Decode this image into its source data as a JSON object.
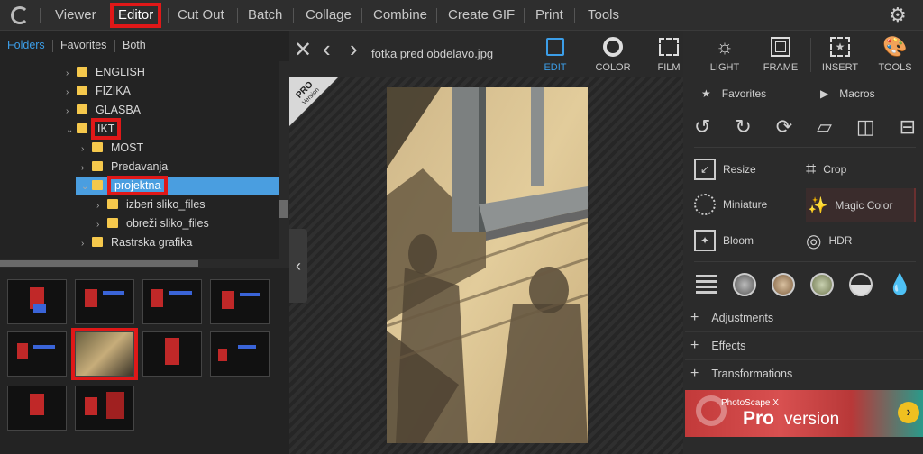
{
  "menu": {
    "viewer": "Viewer",
    "editor": "Editor",
    "cutout": "Cut Out",
    "batch": "Batch",
    "collage": "Collage",
    "combine": "Combine",
    "gif": "Create GIF",
    "print": "Print",
    "tools": "Tools"
  },
  "left_tabs": {
    "folders": "Folders",
    "favorites": "Favorites",
    "both": "Both"
  },
  "tree": [
    "ENGLISH",
    "FIZIKA",
    "GLASBA",
    "IKT",
    "MOST",
    "Predavanja",
    "projektna",
    "izberi sliko_files",
    "obreži sliko_files",
    "Rastrska grafika"
  ],
  "file": {
    "name": "fotka pred obdelavo.jpg"
  },
  "edit_tools": {
    "edit": "EDIT",
    "color": "COLOR",
    "film": "FILM",
    "light": "LIGHT",
    "frame": "FRAME",
    "insert": "INSERT",
    "tools": "TOOLS"
  },
  "badge": {
    "pro": "PRO",
    "version": "Version"
  },
  "right": {
    "favorites": "Favorites",
    "macros": "Macros",
    "resize": "Resize",
    "crop": "Crop",
    "miniature": "Miniature",
    "magic": "Magic Color",
    "bloom": "Bloom",
    "hdr": "HDR",
    "adjustments": "Adjustments",
    "effects": "Effects",
    "transformations": "Transformations"
  },
  "banner": {
    "small": "PhotoScape X",
    "pro": "Pro",
    "version": "version"
  },
  "colors": {
    "accent": "#3c9ee8",
    "highlight": "#e01818",
    "selection": "#4a9ee0"
  }
}
